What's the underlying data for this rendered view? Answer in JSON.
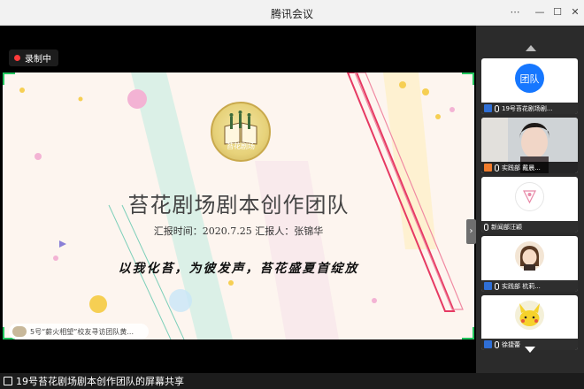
{
  "window": {
    "title": "腾讯会议"
  },
  "recording": {
    "label": "录制中"
  },
  "slide": {
    "title": "苔花剧场剧本创作团队",
    "logo_text": "苔花剧场",
    "meta": "汇报时间：2020.7.25    汇报人：张锦华",
    "slogan": "以我化苔，为彼发声，苔花盛夏首绽放"
  },
  "speaker_pill": {
    "text": "5号“薪火相望”校友寻访团队黄..."
  },
  "participants": [
    {
      "name": "19号苔花剧场剧...",
      "avatar_text": "团队"
    },
    {
      "name": "实践部 戴晨..."
    },
    {
      "name": "新闻部汪颖"
    },
    {
      "name": "实践部 杭莉..."
    },
    {
      "name": "徐捷蕾"
    }
  ],
  "share_bar": {
    "text": "19号苔花剧场剧本创作团队的屏幕共享"
  },
  "colors": {
    "accent_green": "#22c55e",
    "record_red": "#ff3b3b",
    "tile_blue": "#1677ff"
  }
}
